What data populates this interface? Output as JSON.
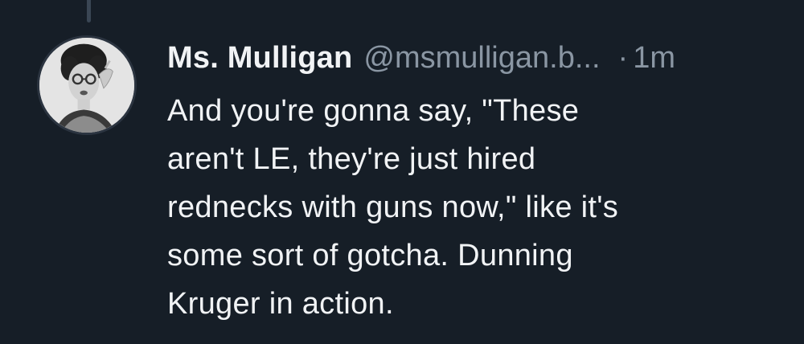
{
  "post": {
    "author": {
      "display_name": "Ms. Mulligan",
      "handle": "@msmulligan.b...",
      "avatar_icon": "profile-avatar-icon"
    },
    "separator": "·",
    "timestamp": "1m",
    "text_lines": [
      "And you're gonna say, \"These",
      "aren't LE, they're just hired",
      "rednecks with guns now,\" like it's",
      "some sort of gotcha. Dunning",
      "Kruger in action."
    ]
  },
  "colors": {
    "background": "#161e27",
    "text_primary": "#f1f3f5",
    "text_secondary": "#8a96a3"
  }
}
